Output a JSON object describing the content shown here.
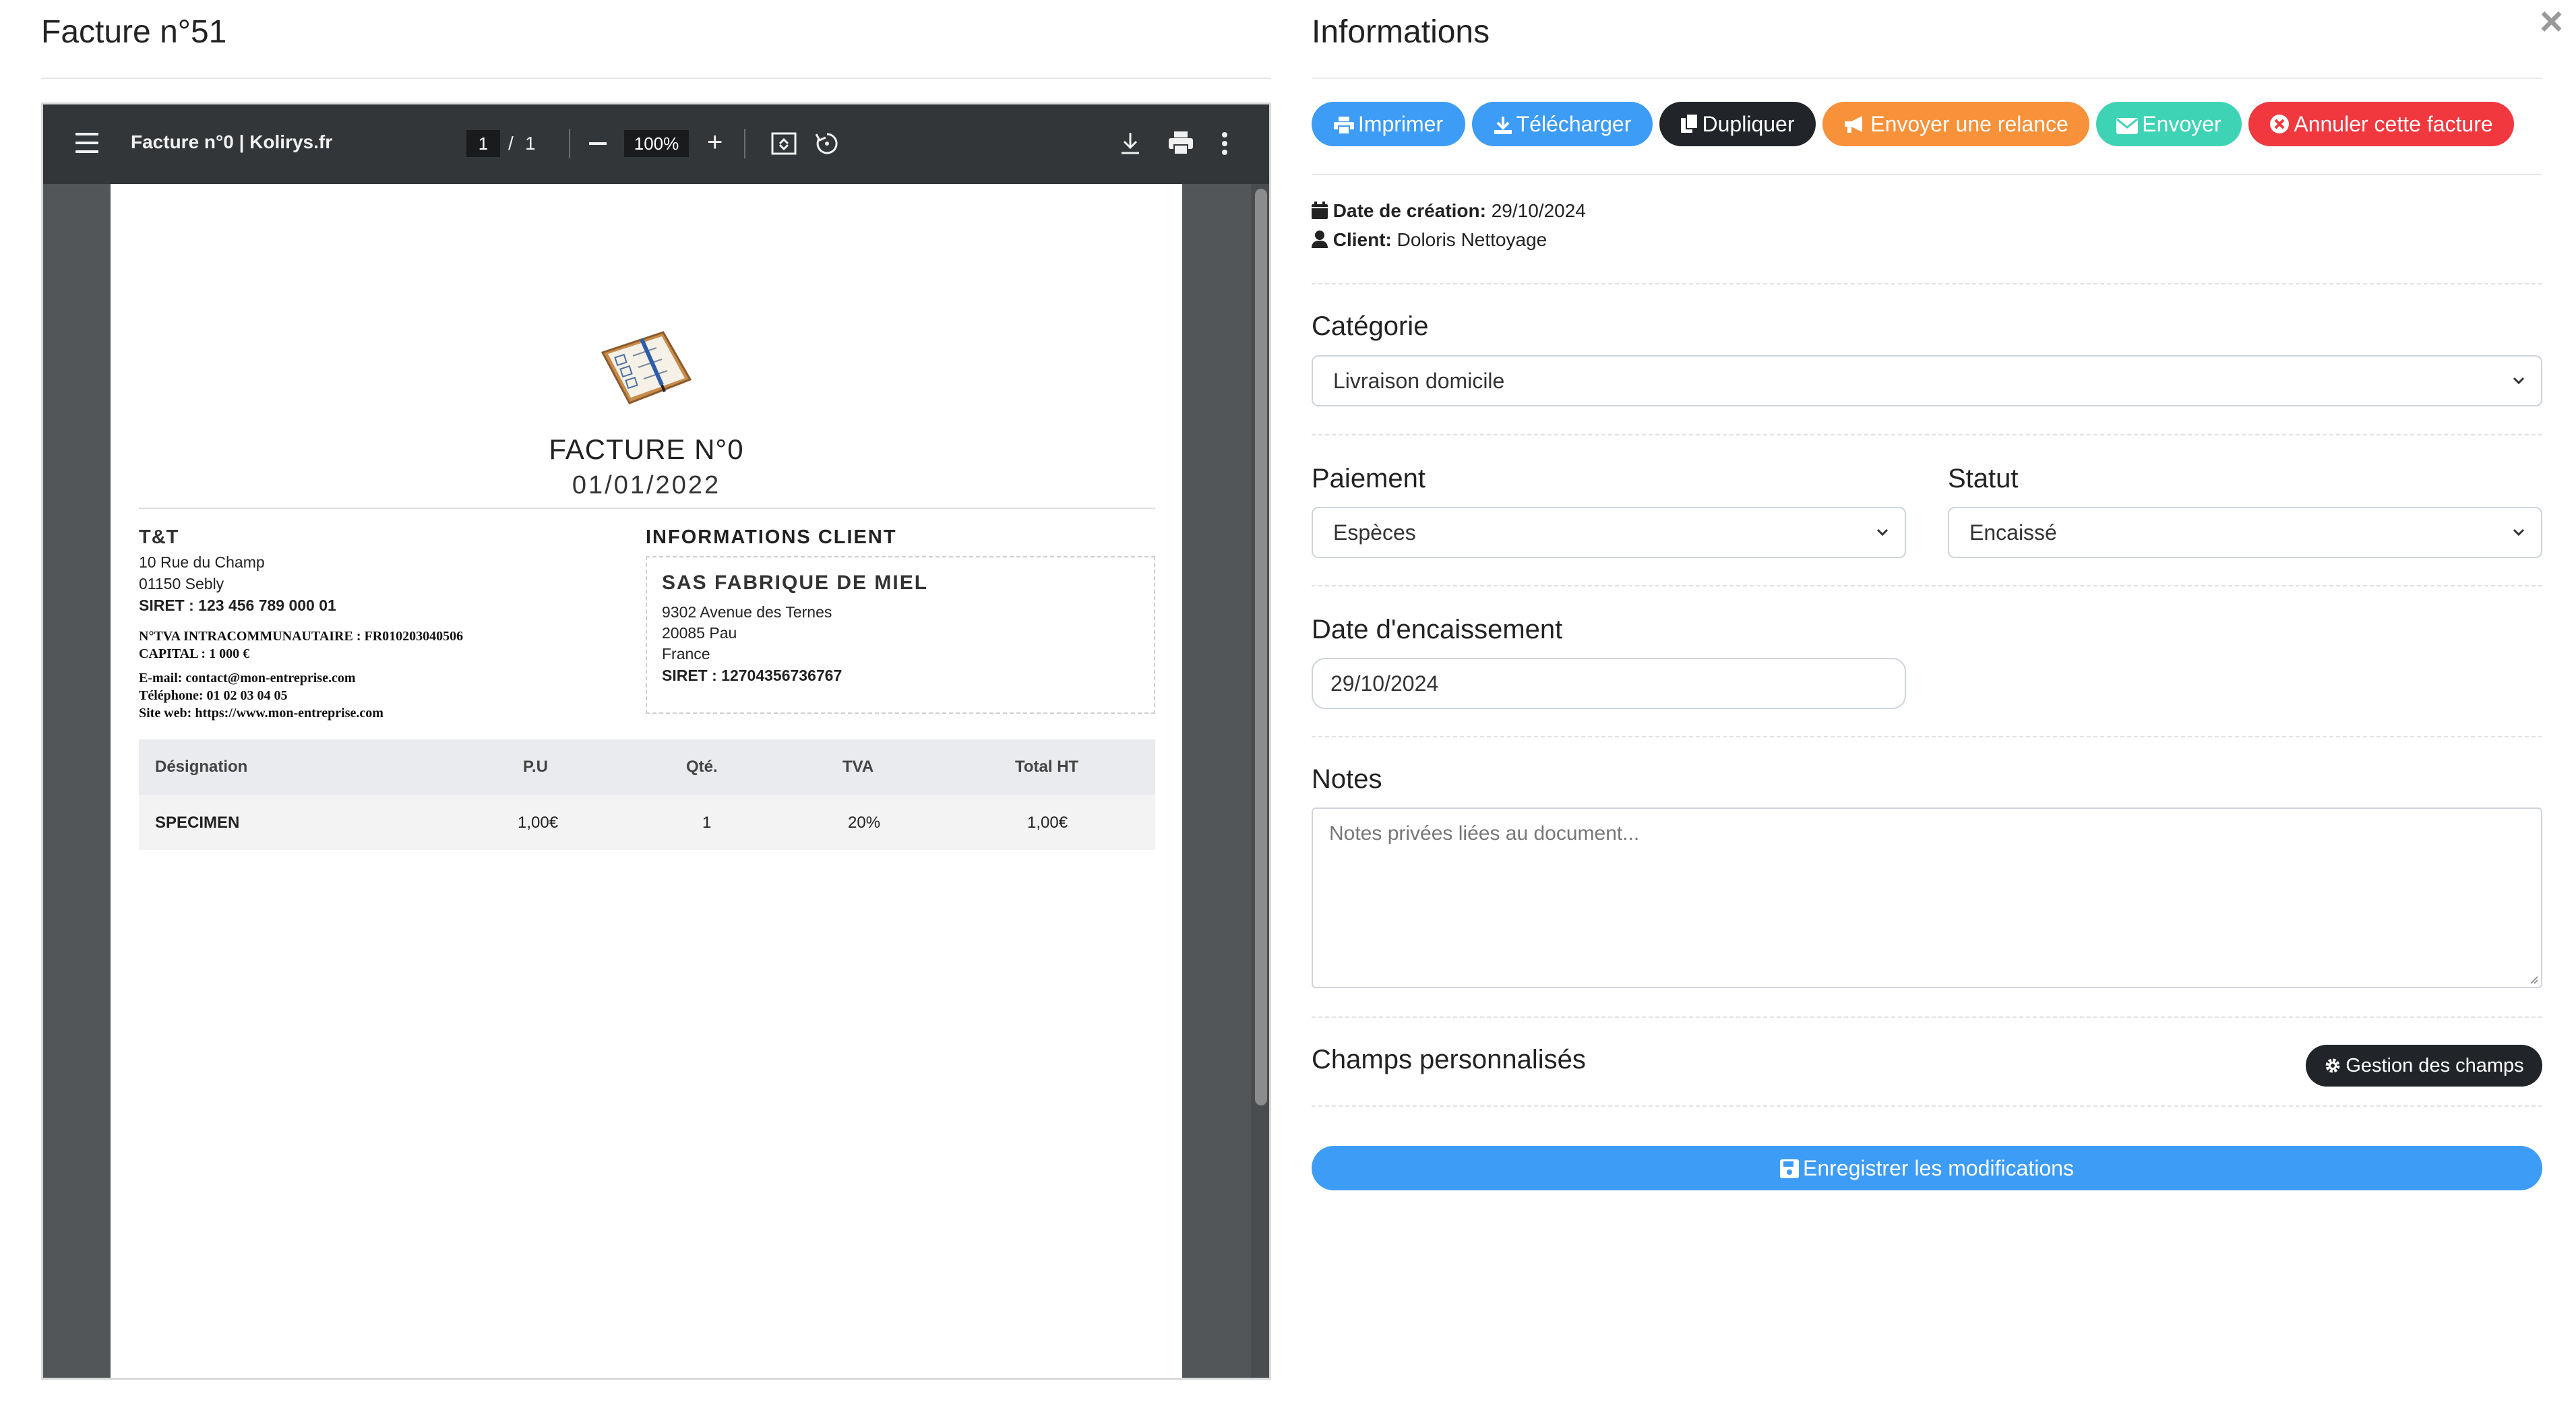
{
  "left": {
    "title": "Facture n°51"
  },
  "viewer": {
    "doc_title": "Facture n°0 | Kolirys.fr",
    "page_current": "1",
    "page_sep": "/",
    "page_total": "1",
    "zoom": "100%"
  },
  "invoice": {
    "title": "FACTURE N°0",
    "date": "01/01/2022",
    "company": {
      "name": "T&T",
      "address1": "10 Rue du Champ",
      "address2": "01150 Sebly",
      "siret": "SIRET : 123 456 789 000 01",
      "tva": "N°TVA INTRACOMMUNAUTAIRE : FR010203040506",
      "capital": "CAPITAL : 1 000 €",
      "email": "E-mail: contact@mon-entreprise.com",
      "phone": "Téléphone: 01 02 03 04 05",
      "web": "Site web: https://www.mon-entreprise.com"
    },
    "client_heading": "INFORMATIONS CLIENT",
    "client": {
      "name": "SAS FABRIQUE DE MIEL",
      "address1": "9302 Avenue des Ternes",
      "address2": "20085 Pau",
      "country": "France",
      "siret": "SIRET : 12704356736767"
    },
    "table": {
      "headers": [
        "Désignation",
        "P.U",
        "Qté.",
        "TVA",
        "Total HT"
      ],
      "rows": [
        [
          "SPECIMEN",
          "1,00€",
          "1",
          "20%",
          "1,00€"
        ]
      ]
    }
  },
  "right": {
    "title": "Informations",
    "buttons": {
      "print": "Imprimer",
      "download": "Télécharger",
      "duplicate": "Dupliquer",
      "reminder": "Envoyer une relance",
      "send": "Envoyer",
      "cancel": "Annuler cette facture"
    },
    "meta": {
      "created_label": "Date de création:",
      "created_value": "29/10/2024",
      "client_label": "Client:",
      "client_value": "Doloris Nettoyage"
    },
    "categorie": {
      "label": "Catégorie",
      "value": "Livraison domicile"
    },
    "paiement": {
      "label": "Paiement",
      "value": "Espèces"
    },
    "statut": {
      "label": "Statut",
      "value": "Encaissé"
    },
    "encaissement": {
      "label": "Date d'encaissement",
      "value": "29/10/2024"
    },
    "notes": {
      "label": "Notes",
      "placeholder": "Notes privées liées au document..."
    },
    "custom_fields": {
      "label": "Champs personnalisés",
      "button": "Gestion des champs"
    },
    "save": "Enregistrer les modifications"
  },
  "colors": {
    "blue": "#3d9cf5",
    "dark": "#212529",
    "orange": "#f7913a",
    "teal": "#3fd3b5",
    "red": "#f0383e"
  }
}
